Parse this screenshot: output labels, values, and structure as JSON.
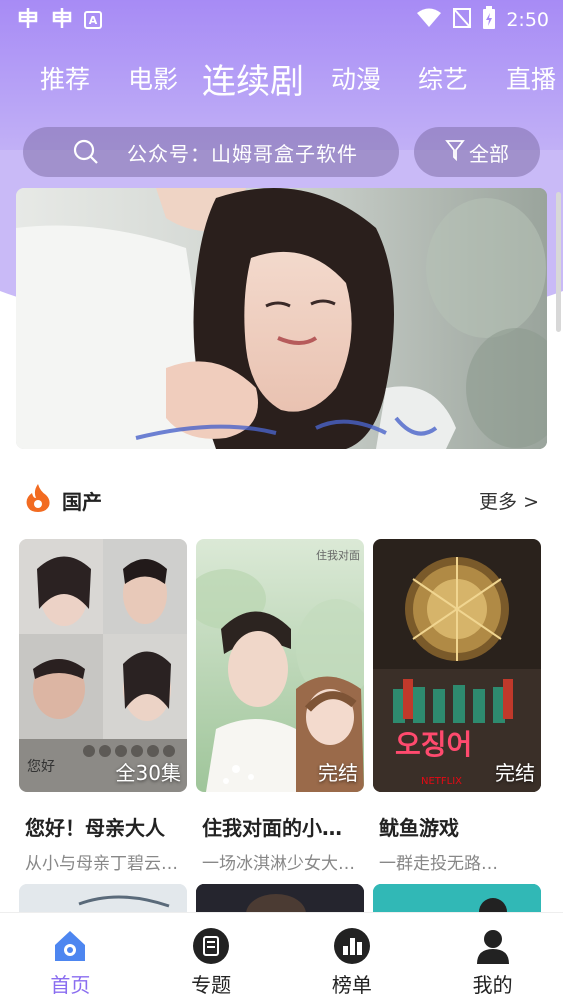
{
  "status_bar": {
    "left_icons": [
      "app-icon-1",
      "app-icon-2",
      "notification-a-icon"
    ],
    "time": "2:50"
  },
  "tabs": [
    {
      "label": "推荐",
      "active": false
    },
    {
      "label": "电影",
      "active": false
    },
    {
      "label": "连续剧",
      "active": true
    },
    {
      "label": "动漫",
      "active": false
    },
    {
      "label": "综艺",
      "active": false
    },
    {
      "label": "直播",
      "active": false
    }
  ],
  "search": {
    "text": "公众号：山姆哥盒子软件",
    "filter_label": "全部"
  },
  "section": {
    "title": "国产",
    "more_label": "更多 >"
  },
  "cards": [
    {
      "title": "您好！母亲大人",
      "subtitle": "从小与母亲丁碧云…",
      "badge": "全30集"
    },
    {
      "title": "住我对面的小…",
      "subtitle": "一场冰淇淋少女大…",
      "badge": "完结"
    },
    {
      "title": "鱿鱼游戏",
      "subtitle": "一群走投无路…",
      "badge": "完结"
    }
  ],
  "bottom_nav": [
    {
      "label": "首页",
      "icon": "home-icon",
      "active": true
    },
    {
      "label": "专题",
      "icon": "topics-icon",
      "active": false
    },
    {
      "label": "榜单",
      "icon": "ranking-icon",
      "active": false
    },
    {
      "label": "我的",
      "icon": "profile-icon",
      "active": false
    }
  ],
  "colors": {
    "accent": "#8a6df0",
    "header_top": "#a78bf5",
    "header_bottom": "#c9baf7",
    "fire": "#f26b21"
  }
}
